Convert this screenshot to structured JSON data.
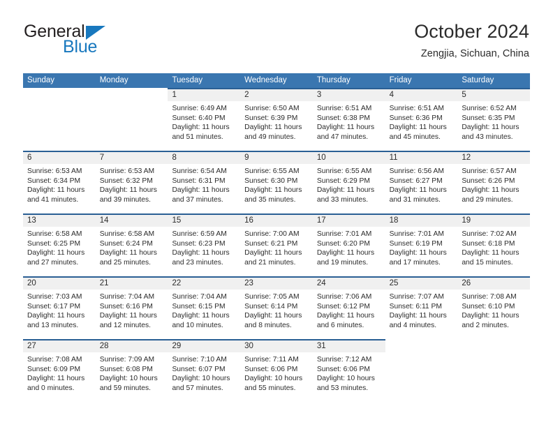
{
  "brand": {
    "name_part1": "General",
    "name_part2": "Blue",
    "flag_icon": "triangle-flag-icon",
    "primary_color": "#1878be"
  },
  "header": {
    "title": "October 2024",
    "location": "Zengjia, Sichuan, China"
  },
  "theme": {
    "header_blue": "#3a76b0",
    "row_rule_blue": "#2a5f94",
    "daynum_band": "#f0f0f0",
    "text": "#2b2b2b"
  },
  "calendar": {
    "weekday_headers": [
      "Sunday",
      "Monday",
      "Tuesday",
      "Wednesday",
      "Thursday",
      "Friday",
      "Saturday"
    ],
    "weeks": [
      [
        {
          "day": "",
          "lines": []
        },
        {
          "day": "",
          "lines": []
        },
        {
          "day": "1",
          "lines": [
            "Sunrise: 6:49 AM",
            "Sunset: 6:40 PM",
            "Daylight: 11 hours",
            "and 51 minutes."
          ]
        },
        {
          "day": "2",
          "lines": [
            "Sunrise: 6:50 AM",
            "Sunset: 6:39 PM",
            "Daylight: 11 hours",
            "and 49 minutes."
          ]
        },
        {
          "day": "3",
          "lines": [
            "Sunrise: 6:51 AM",
            "Sunset: 6:38 PM",
            "Daylight: 11 hours",
            "and 47 minutes."
          ]
        },
        {
          "day": "4",
          "lines": [
            "Sunrise: 6:51 AM",
            "Sunset: 6:36 PM",
            "Daylight: 11 hours",
            "and 45 minutes."
          ]
        },
        {
          "day": "5",
          "lines": [
            "Sunrise: 6:52 AM",
            "Sunset: 6:35 PM",
            "Daylight: 11 hours",
            "and 43 minutes."
          ]
        }
      ],
      [
        {
          "day": "6",
          "lines": [
            "Sunrise: 6:53 AM",
            "Sunset: 6:34 PM",
            "Daylight: 11 hours",
            "and 41 minutes."
          ]
        },
        {
          "day": "7",
          "lines": [
            "Sunrise: 6:53 AM",
            "Sunset: 6:32 PM",
            "Daylight: 11 hours",
            "and 39 minutes."
          ]
        },
        {
          "day": "8",
          "lines": [
            "Sunrise: 6:54 AM",
            "Sunset: 6:31 PM",
            "Daylight: 11 hours",
            "and 37 minutes."
          ]
        },
        {
          "day": "9",
          "lines": [
            "Sunrise: 6:55 AM",
            "Sunset: 6:30 PM",
            "Daylight: 11 hours",
            "and 35 minutes."
          ]
        },
        {
          "day": "10",
          "lines": [
            "Sunrise: 6:55 AM",
            "Sunset: 6:29 PM",
            "Daylight: 11 hours",
            "and 33 minutes."
          ]
        },
        {
          "day": "11",
          "lines": [
            "Sunrise: 6:56 AM",
            "Sunset: 6:27 PM",
            "Daylight: 11 hours",
            "and 31 minutes."
          ]
        },
        {
          "day": "12",
          "lines": [
            "Sunrise: 6:57 AM",
            "Sunset: 6:26 PM",
            "Daylight: 11 hours",
            "and 29 minutes."
          ]
        }
      ],
      [
        {
          "day": "13",
          "lines": [
            "Sunrise: 6:58 AM",
            "Sunset: 6:25 PM",
            "Daylight: 11 hours",
            "and 27 minutes."
          ]
        },
        {
          "day": "14",
          "lines": [
            "Sunrise: 6:58 AM",
            "Sunset: 6:24 PM",
            "Daylight: 11 hours",
            "and 25 minutes."
          ]
        },
        {
          "day": "15",
          "lines": [
            "Sunrise: 6:59 AM",
            "Sunset: 6:23 PM",
            "Daylight: 11 hours",
            "and 23 minutes."
          ]
        },
        {
          "day": "16",
          "lines": [
            "Sunrise: 7:00 AM",
            "Sunset: 6:21 PM",
            "Daylight: 11 hours",
            "and 21 minutes."
          ]
        },
        {
          "day": "17",
          "lines": [
            "Sunrise: 7:01 AM",
            "Sunset: 6:20 PM",
            "Daylight: 11 hours",
            "and 19 minutes."
          ]
        },
        {
          "day": "18",
          "lines": [
            "Sunrise: 7:01 AM",
            "Sunset: 6:19 PM",
            "Daylight: 11 hours",
            "and 17 minutes."
          ]
        },
        {
          "day": "19",
          "lines": [
            "Sunrise: 7:02 AM",
            "Sunset: 6:18 PM",
            "Daylight: 11 hours",
            "and 15 minutes."
          ]
        }
      ],
      [
        {
          "day": "20",
          "lines": [
            "Sunrise: 7:03 AM",
            "Sunset: 6:17 PM",
            "Daylight: 11 hours",
            "and 13 minutes."
          ]
        },
        {
          "day": "21",
          "lines": [
            "Sunrise: 7:04 AM",
            "Sunset: 6:16 PM",
            "Daylight: 11 hours",
            "and 12 minutes."
          ]
        },
        {
          "day": "22",
          "lines": [
            "Sunrise: 7:04 AM",
            "Sunset: 6:15 PM",
            "Daylight: 11 hours",
            "and 10 minutes."
          ]
        },
        {
          "day": "23",
          "lines": [
            "Sunrise: 7:05 AM",
            "Sunset: 6:14 PM",
            "Daylight: 11 hours",
            "and 8 minutes."
          ]
        },
        {
          "day": "24",
          "lines": [
            "Sunrise: 7:06 AM",
            "Sunset: 6:12 PM",
            "Daylight: 11 hours",
            "and 6 minutes."
          ]
        },
        {
          "day": "25",
          "lines": [
            "Sunrise: 7:07 AM",
            "Sunset: 6:11 PM",
            "Daylight: 11 hours",
            "and 4 minutes."
          ]
        },
        {
          "day": "26",
          "lines": [
            "Sunrise: 7:08 AM",
            "Sunset: 6:10 PM",
            "Daylight: 11 hours",
            "and 2 minutes."
          ]
        }
      ],
      [
        {
          "day": "27",
          "lines": [
            "Sunrise: 7:08 AM",
            "Sunset: 6:09 PM",
            "Daylight: 11 hours",
            "and 0 minutes."
          ]
        },
        {
          "day": "28",
          "lines": [
            "Sunrise: 7:09 AM",
            "Sunset: 6:08 PM",
            "Daylight: 10 hours",
            "and 59 minutes."
          ]
        },
        {
          "day": "29",
          "lines": [
            "Sunrise: 7:10 AM",
            "Sunset: 6:07 PM",
            "Daylight: 10 hours",
            "and 57 minutes."
          ]
        },
        {
          "day": "30",
          "lines": [
            "Sunrise: 7:11 AM",
            "Sunset: 6:06 PM",
            "Daylight: 10 hours",
            "and 55 minutes."
          ]
        },
        {
          "day": "31",
          "lines": [
            "Sunrise: 7:12 AM",
            "Sunset: 6:06 PM",
            "Daylight: 10 hours",
            "and 53 minutes."
          ]
        },
        {
          "day": "",
          "lines": []
        },
        {
          "day": "",
          "lines": []
        }
      ]
    ]
  }
}
